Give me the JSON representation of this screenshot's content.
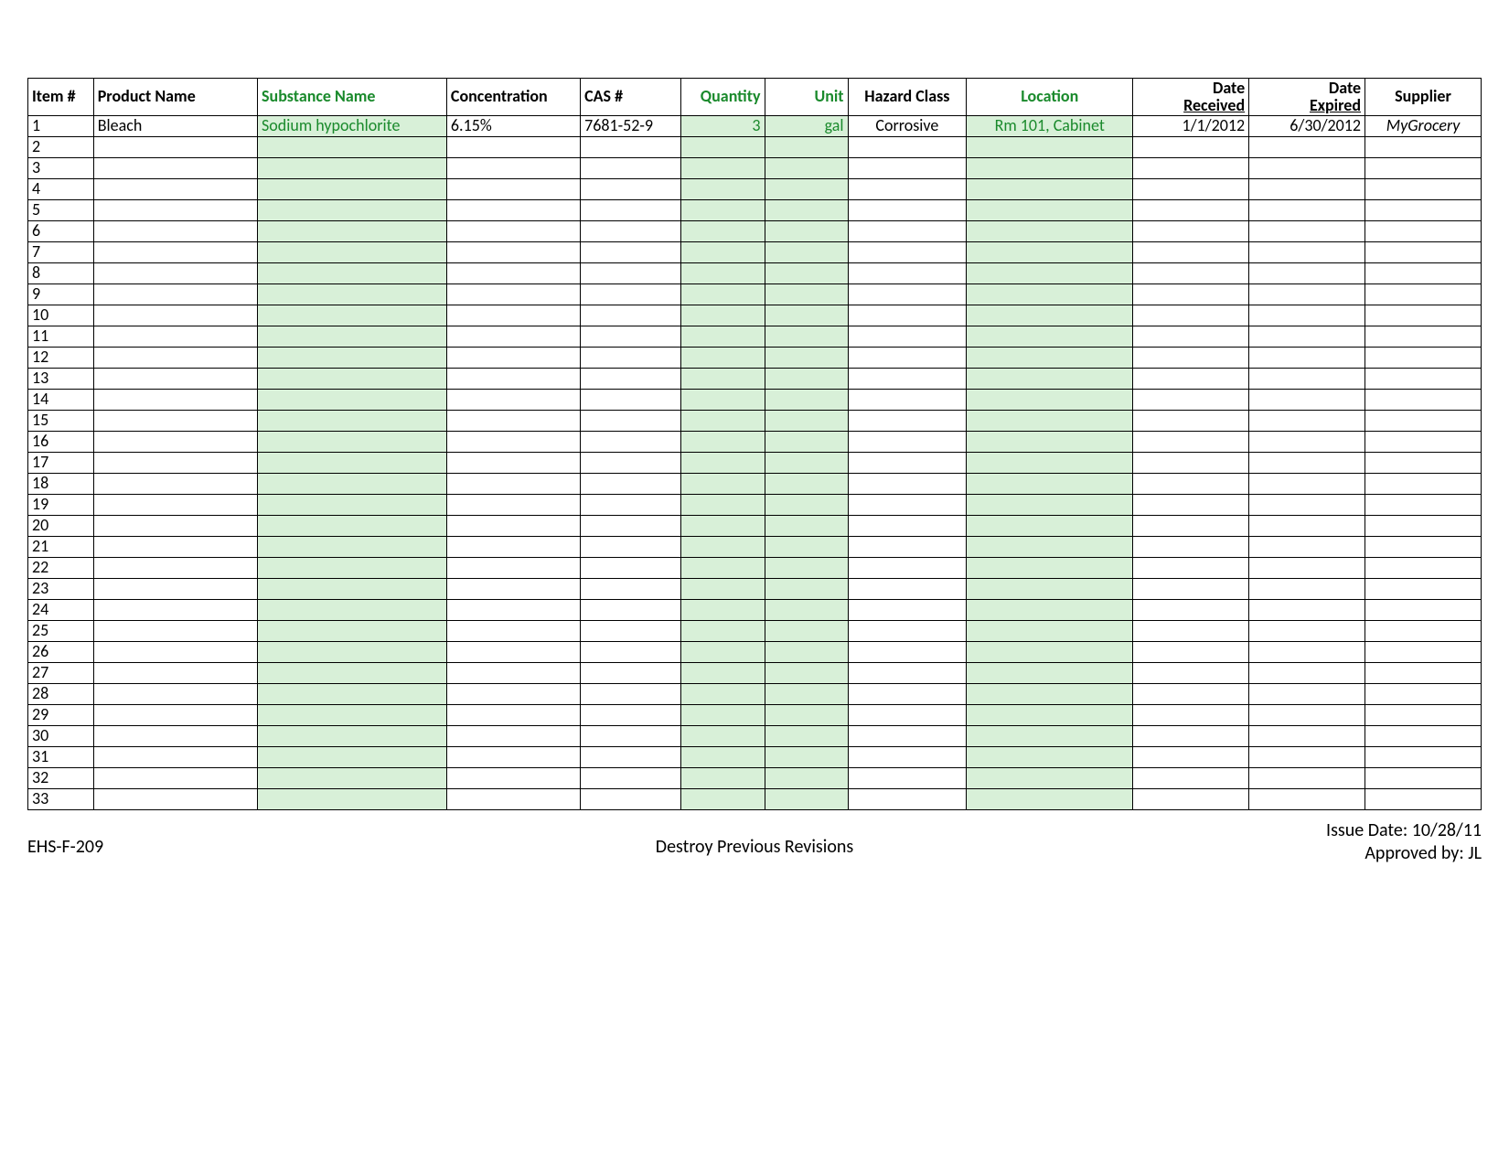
{
  "headers": {
    "item": "Item #",
    "product": "Product Name",
    "substance": "Substance Name",
    "concentration": "Concentration",
    "cas": "CAS #",
    "quantity": "Quantity",
    "unit": "Unit",
    "hazard": "Hazard Class",
    "location": "Location",
    "date_received_top": "Date",
    "date_received_bot": "Received",
    "date_expired_top": "Date",
    "date_expired_bot": "Expired",
    "supplier": "Supplier"
  },
  "row1": {
    "item": "1",
    "product": "Bleach",
    "substance": "Sodium hypochlorite",
    "concentration": "6.15%",
    "cas": "7681-52-9",
    "quantity": "3",
    "unit": "gal",
    "hazard": "Corrosive",
    "location": "Rm 101, Cabinet",
    "date_received": "1/1/2012",
    "date_expired": "6/30/2012",
    "supplier": "MyGrocery"
  },
  "row_numbers": [
    "2",
    "3",
    "4",
    "5",
    "6",
    "7",
    "8",
    "9",
    "10",
    "11",
    "12",
    "13",
    "14",
    "15",
    "16",
    "17",
    "18",
    "19",
    "20",
    "21",
    "22",
    "23",
    "24",
    "25",
    "26",
    "27",
    "28",
    "29",
    "30",
    "31",
    "32",
    "33"
  ],
  "footer": {
    "form": "EHS-F-209",
    "center": "Destroy Previous Revisions",
    "issue": "Issue Date: 10/28/11",
    "approved": "Approved by: JL"
  }
}
